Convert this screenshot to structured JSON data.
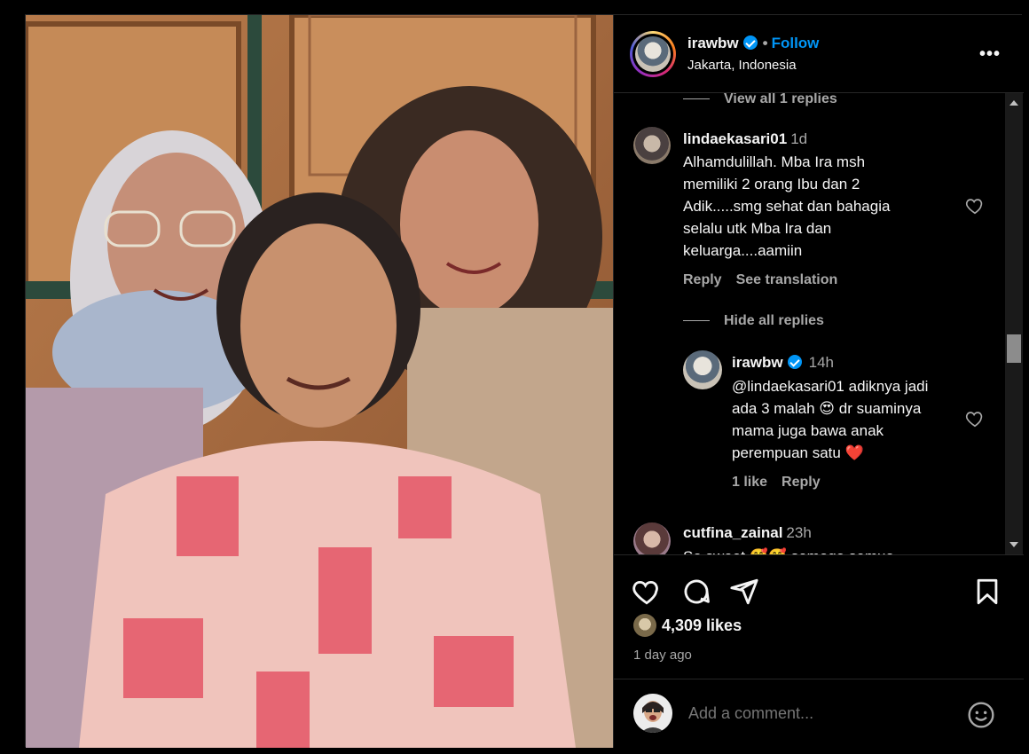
{
  "header": {
    "username": "irawbw",
    "separator": "•",
    "follow_label": "Follow",
    "location": "Jakarta, Indonesia",
    "more_label": "•••"
  },
  "comments": {
    "view_replies_top": "View all 1 replies",
    "items": [
      {
        "username": "lindaekasari01",
        "time": "1d",
        "lines": [
          "Alhamdulillah. Mba Ira msh",
          "memiliki 2 orang Ibu dan 2",
          "Adik.....smg sehat dan bahagia",
          "selalu utk Mba Ira dan",
          "keluarga....aamiin"
        ],
        "reply_label": "Reply",
        "translate_label": "See translation"
      }
    ],
    "hide_replies": "Hide all replies",
    "reply": {
      "username": "irawbw",
      "time": "14h",
      "lines": [
        "@lindaekasari01 adiknya jadi",
        "ada 3 malah 😍 dr suaminya",
        "mama juga bawa anak",
        "perempuan satu ❤️"
      ],
      "likes_label": "1 like",
      "reply_label": "Reply"
    },
    "next": {
      "username": "cutfina_zainal",
      "time": "23h",
      "partial_text": "So sweet 🥰🥰 semoga semua"
    }
  },
  "footer": {
    "likes": "4,309 likes",
    "date": "1 day ago",
    "add_comment_placeholder": "Add a comment..."
  },
  "icons": {
    "heart": "heart-icon",
    "comment": "comment-icon",
    "share": "share-icon",
    "save": "bookmark-icon",
    "emoji": "emoji-icon"
  },
  "colors": {
    "accent": "#0095f6",
    "background": "#000000",
    "muted": "#a8a8a8",
    "heart_red": "#ed4956"
  }
}
